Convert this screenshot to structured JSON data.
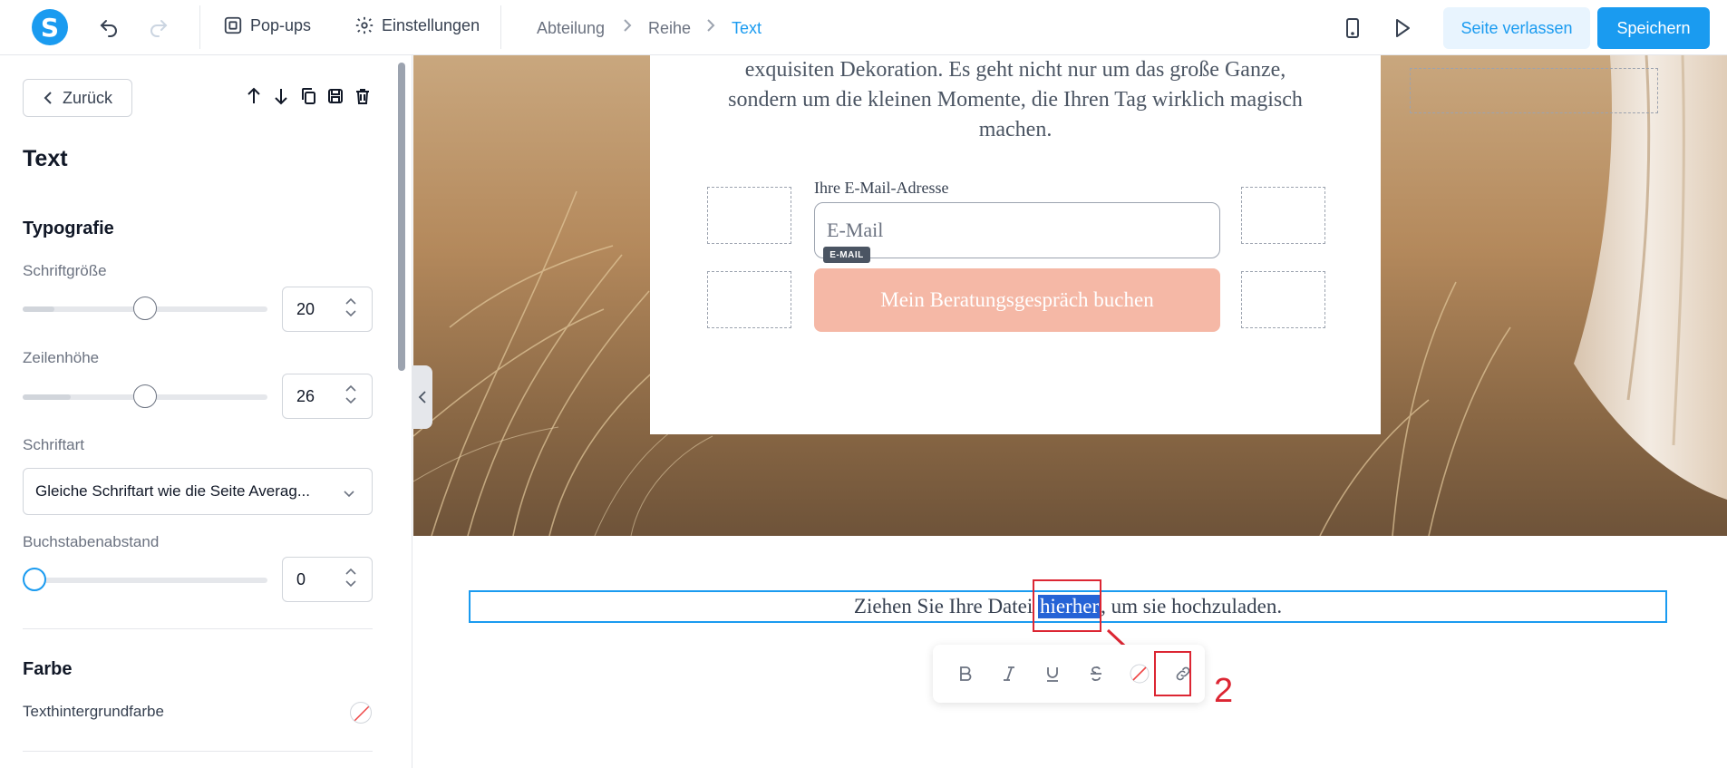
{
  "toolbar": {
    "logo": "S",
    "popups_label": "Pop-ups",
    "settings_label": "Einstellungen",
    "breadcrumb": [
      "Abteilung",
      "Reihe",
      "Text"
    ],
    "leave_label": "Seite verlassen",
    "save_label": "Speichern"
  },
  "sidebar": {
    "back_label": "Zurück",
    "title": "Text",
    "typography": {
      "heading": "Typografie",
      "font_size_label": "Schriftgröße",
      "font_size_value": "20",
      "line_height_label": "Zeilenhöhe",
      "line_height_value": "26",
      "font_label": "Schriftart",
      "font_value": "Gleiche Schriftart wie die Seite Averag...",
      "letter_spacing_label": "Buchstabenabstand",
      "letter_spacing_value": "0"
    },
    "color": {
      "heading": "Farbe",
      "bg_label": "Texthintergrundfarbe"
    }
  },
  "canvas": {
    "card_text_lines": [
      "exquisiten Dekoration. Es geht nicht nur um das große Ganze,",
      "sondern um die kleinen Momente, die Ihren Tag wirklich magisch",
      "machen."
    ],
    "email_label": "Ihre E-Mail-Adresse",
    "email_placeholder": "E-Mail",
    "email_badge": "E-MAIL",
    "cta_label": "Mein Beratungsgespräch buchen",
    "text_before": "Ziehen Sie Ihre Datei ",
    "text_selected": "hierher",
    "text_after": ", um sie hochzuladen.",
    "step_number": "2"
  },
  "colors": {
    "accent": "#1a9bf0",
    "cta": "#f5b8a6",
    "selection": "#2563d6",
    "annotation": "#dc2633"
  }
}
